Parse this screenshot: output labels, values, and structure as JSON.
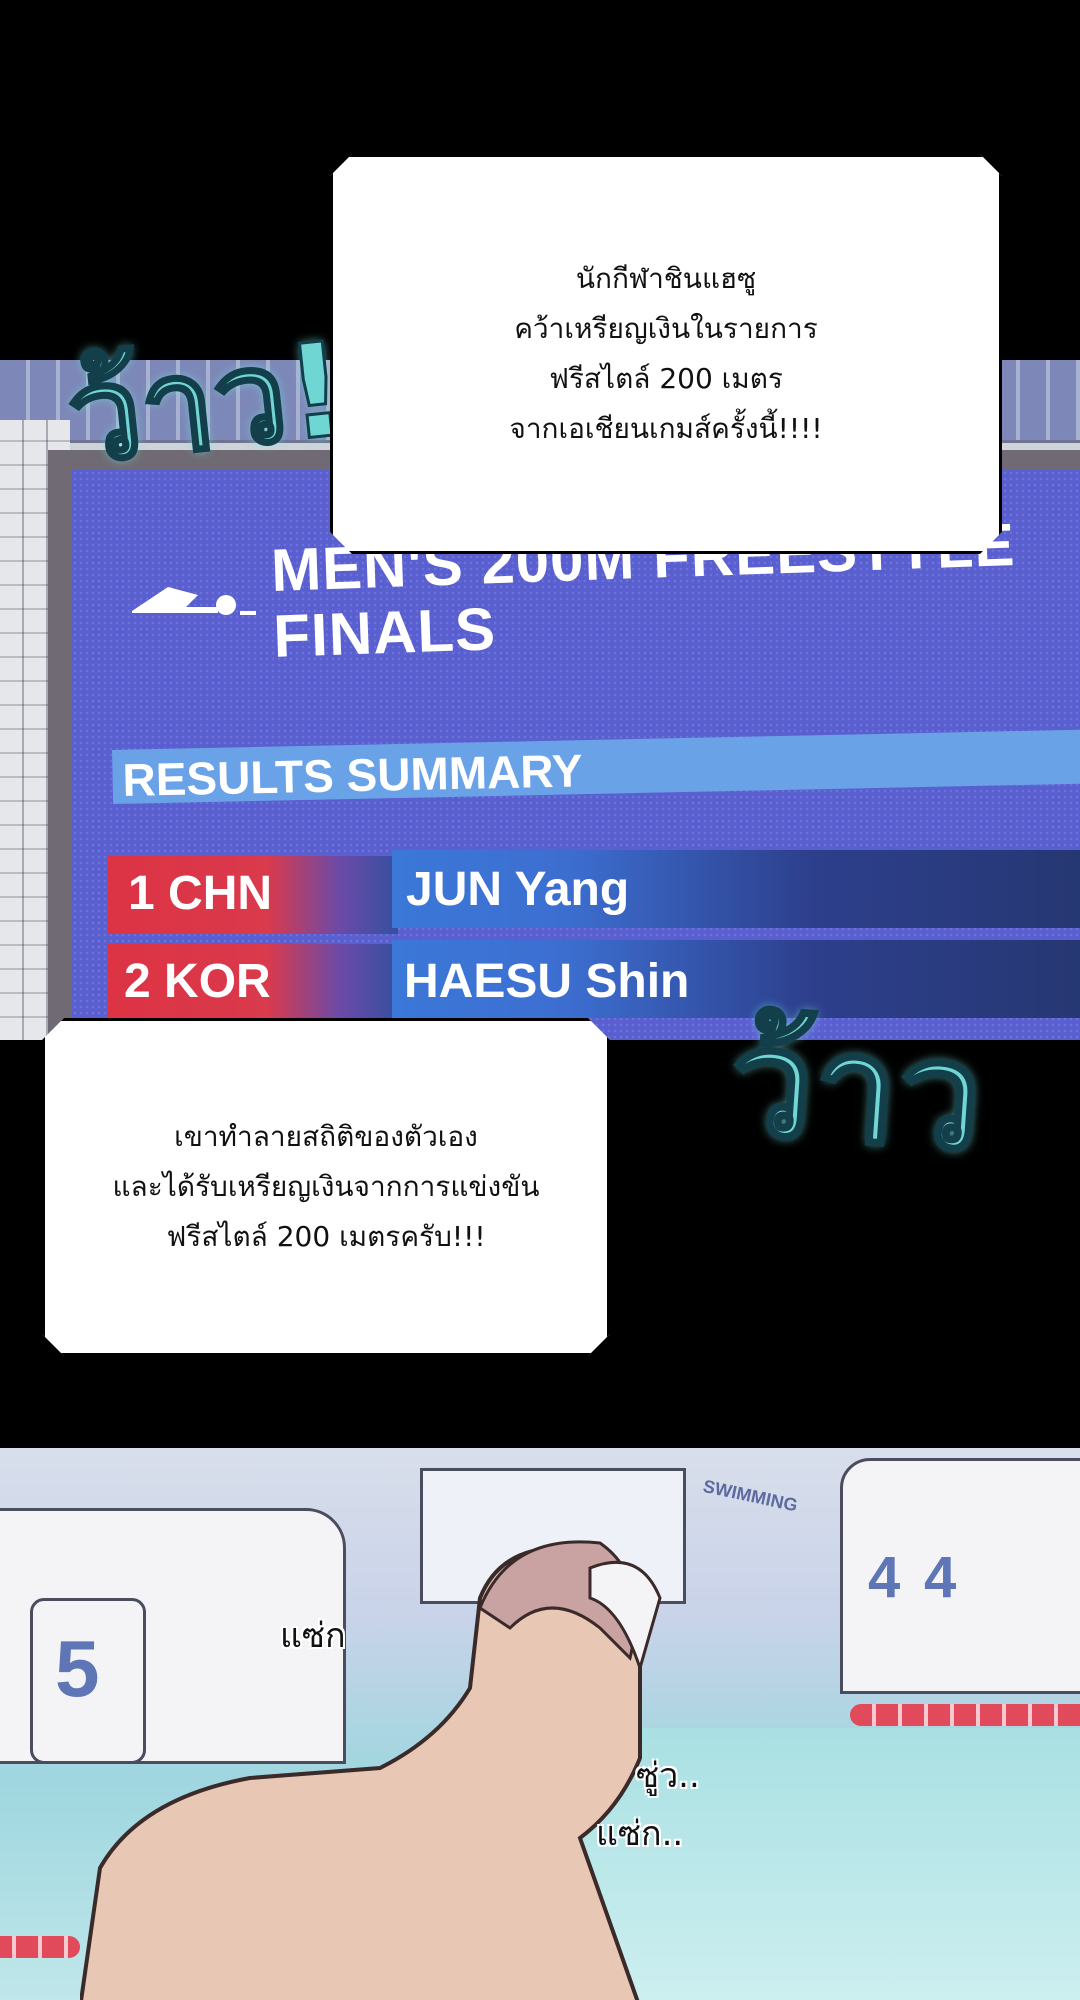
{
  "scoreboard": {
    "title_line1": "MEN'S 200M FREESTYLE",
    "title_line2": "FINALS",
    "results_label": "RESULTS SUMMARY",
    "rows": [
      {
        "rank_country": "1 CHN",
        "name": "JUN Yang"
      },
      {
        "rank_country": "2 KOR",
        "name": "HAESU Shin"
      }
    ]
  },
  "bubble_top": {
    "lines": [
      "นักกีฬาชินแฮซู",
      "คว้าเหรียญเงินในรายการ",
      "ฟรีสไตล์ 200 เมตร",
      "จากเอเชียนเกมส์ครั้งนี้!!!!"
    ]
  },
  "bubble_bottom": {
    "lines": [
      "เขาทำลายสถิติของตัวเอง",
      "และได้รับเหรียญเงินจากการแข่งขัน",
      "ฟรีสไตล์ 200 เมตรครับ!!!"
    ]
  },
  "sfx": {
    "cheer_top": "ว้าว!",
    "cheer_bottom": "ว้าว",
    "splash1": "แซ่ก",
    "splash2": "ซู่ว..",
    "splash3": "แซ่ก.."
  },
  "pool": {
    "lane_left": "5",
    "lane_right_a": "4",
    "lane_right_b": "4",
    "sign": "SWIMMING"
  },
  "colors": {
    "board_blue": "#5a5fd0",
    "rank_red": "#dd3344",
    "name_blue": "#3b78d8",
    "sfx_cyan": "#6fd6d4"
  }
}
